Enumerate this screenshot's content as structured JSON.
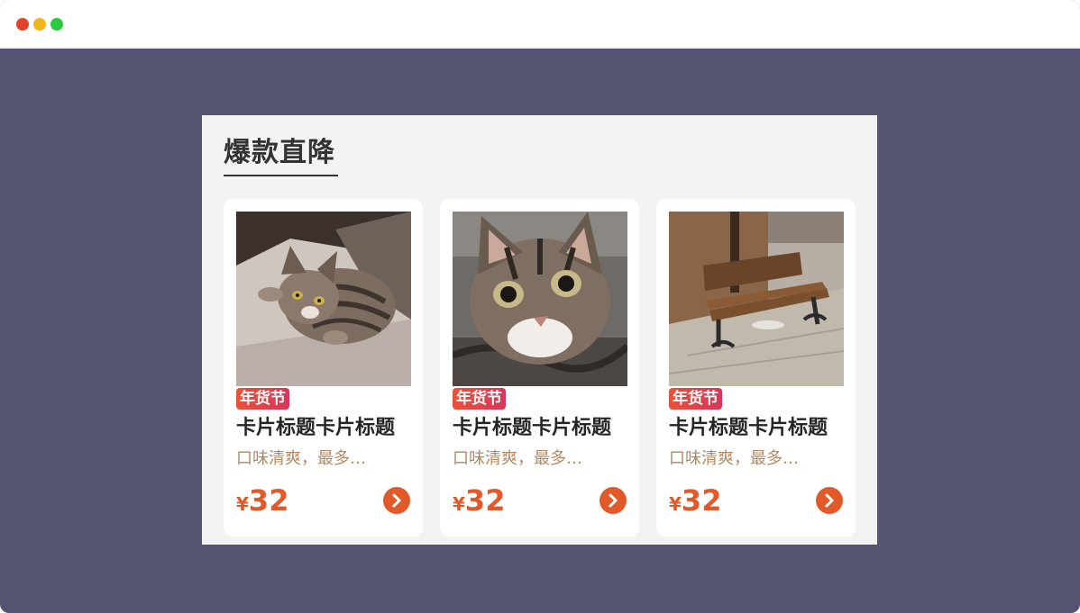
{
  "window": {
    "controls": [
      "close",
      "minimize",
      "maximize"
    ]
  },
  "section": {
    "title": "爆款直降"
  },
  "colors": {
    "background": "#545472",
    "panel": "#f3f3f3",
    "accent": "#e2592a",
    "badge": "#d9355a",
    "desc": "#b08a63"
  },
  "cards": [
    {
      "image": "kitten-lying-on-carpet",
      "badge": "年货节",
      "title": "卡片标题卡片标题",
      "desc": "口味清爽，最多…",
      "currency": "¥",
      "price": "32",
      "action_icon": "chevron-right-icon"
    },
    {
      "image": "kitten-face-closeup",
      "badge": "年货节",
      "title": "卡片标题卡片标题",
      "desc": "口味清爽，最多…",
      "currency": "¥",
      "price": "32",
      "action_icon": "chevron-right-icon"
    },
    {
      "image": "wooden-bench-by-wall",
      "badge": "年货节",
      "title": "卡片标题卡片标题",
      "desc": "口味清爽，最多…",
      "currency": "¥",
      "price": "32",
      "action_icon": "chevron-right-icon"
    }
  ]
}
